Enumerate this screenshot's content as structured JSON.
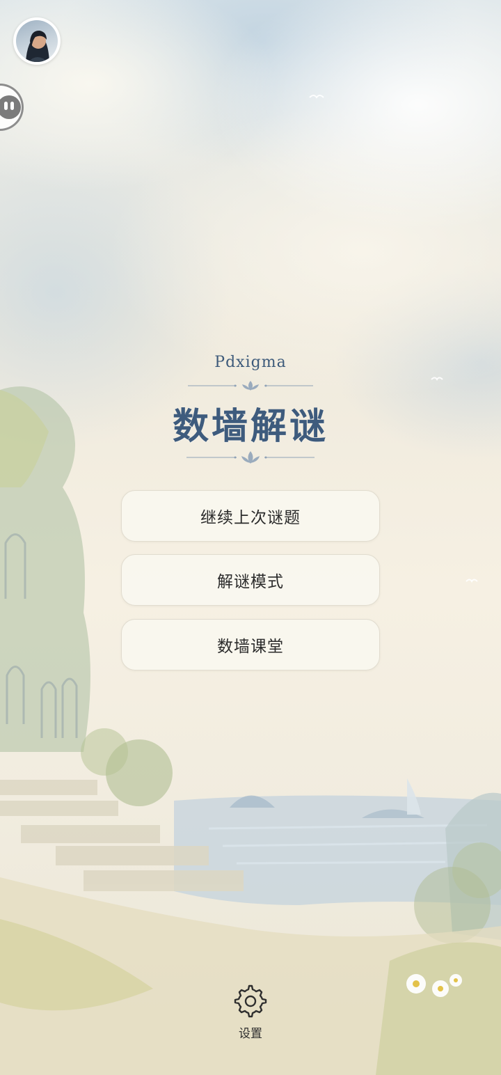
{
  "header": {
    "avatar_alt": "user avatar"
  },
  "brand": "Pdxigma",
  "title": "数墙解谜",
  "menu": [
    {
      "label": "继续上次谜题"
    },
    {
      "label": "解谜模式"
    },
    {
      "label": "数墙课堂"
    }
  ],
  "footer": {
    "settings_label": "设置",
    "settings_icon": "gear-icon"
  },
  "colors": {
    "title": "#3e5b7d",
    "brand": "#3d5a7a",
    "button_bg": "#faf7f0",
    "button_border": "#e1dccf"
  }
}
